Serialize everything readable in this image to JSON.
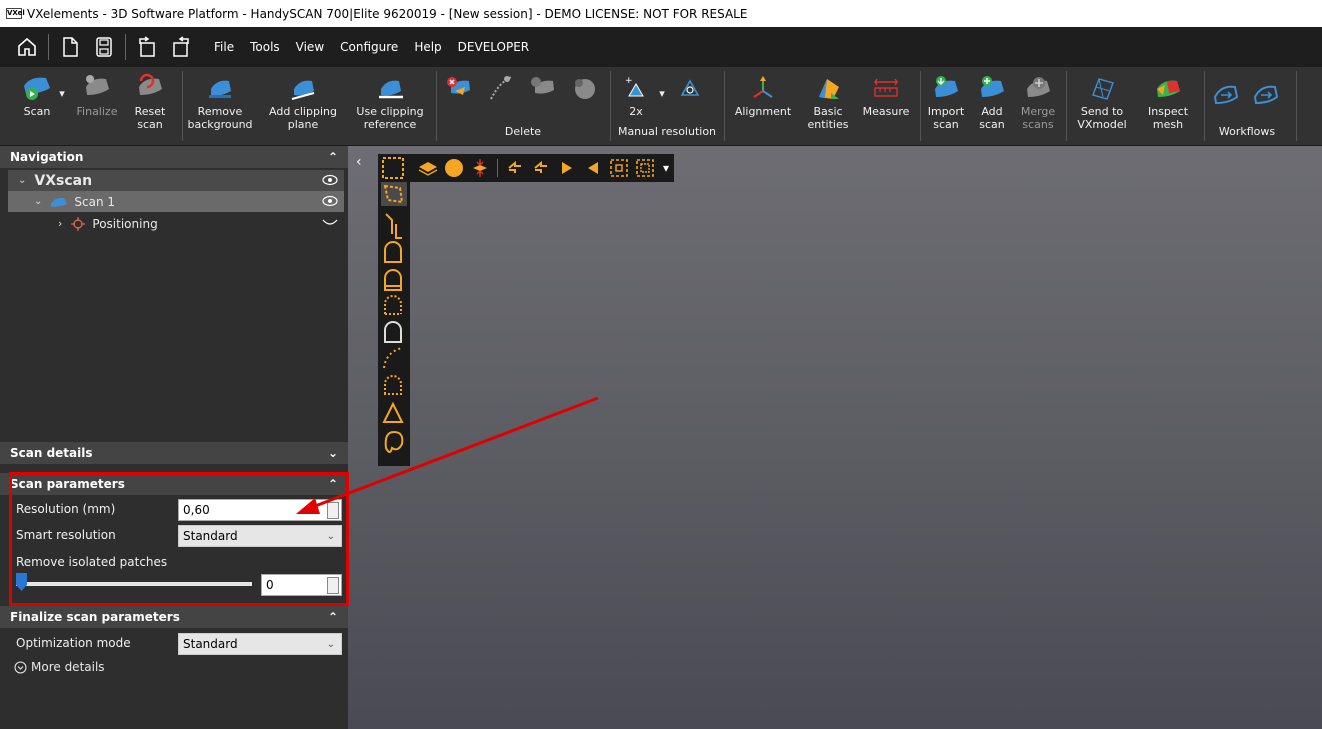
{
  "window": {
    "app_icon_text": "VXel",
    "title": "VXelements - 3D Software Platform - HandySCAN 700|Elite 9620019 - [New session] - DEMO LICENSE: NOT FOR RESALE"
  },
  "menu": [
    "File",
    "Tools",
    "View",
    "Configure",
    "Help",
    "DEVELOPER"
  ],
  "ribbon": {
    "scan": "Scan",
    "finalize": "Finalize",
    "reset": [
      "Reset",
      "scan"
    ],
    "remove_bg": [
      "Remove",
      "background"
    ],
    "add_clip": [
      "Add clipping",
      "plane"
    ],
    "use_clip": [
      "Use clipping",
      "reference"
    ],
    "delete_group": "Delete",
    "res_2x": "2x",
    "manual_res_group": "Manual resolution",
    "alignment": "Alignment",
    "basic": [
      "Basic",
      "entities"
    ],
    "measure": "Measure",
    "import": [
      "Import",
      "scan"
    ],
    "add_scan": [
      "Add",
      "scan"
    ],
    "merge": [
      "Merge",
      "scans"
    ],
    "send": [
      "Send to",
      "VXmodel"
    ],
    "inspect": [
      "Inspect",
      "mesh"
    ],
    "workflows_group": "Workflows"
  },
  "navigation": {
    "title": "Navigation",
    "root": "VXscan",
    "scan": "Scan 1",
    "positioning": "Positioning"
  },
  "scan_details": {
    "title": "Scan details"
  },
  "scan_parameters": {
    "title": "Scan parameters",
    "resolution_label": "Resolution (mm)",
    "resolution_value": "0,60",
    "smart_label": "Smart resolution",
    "smart_value": "Standard",
    "isolated_label": "Remove isolated patches",
    "isolated_value": "0",
    "isolated_level": 0
  },
  "finalize_parameters": {
    "title": "Finalize scan parameters",
    "opt_label": "Optimization mode",
    "opt_value": "Standard",
    "more": "More details"
  },
  "colors": {
    "accent": "#f5a623",
    "scan_blue": "#3a8fd6",
    "highlight": "#e00000"
  }
}
